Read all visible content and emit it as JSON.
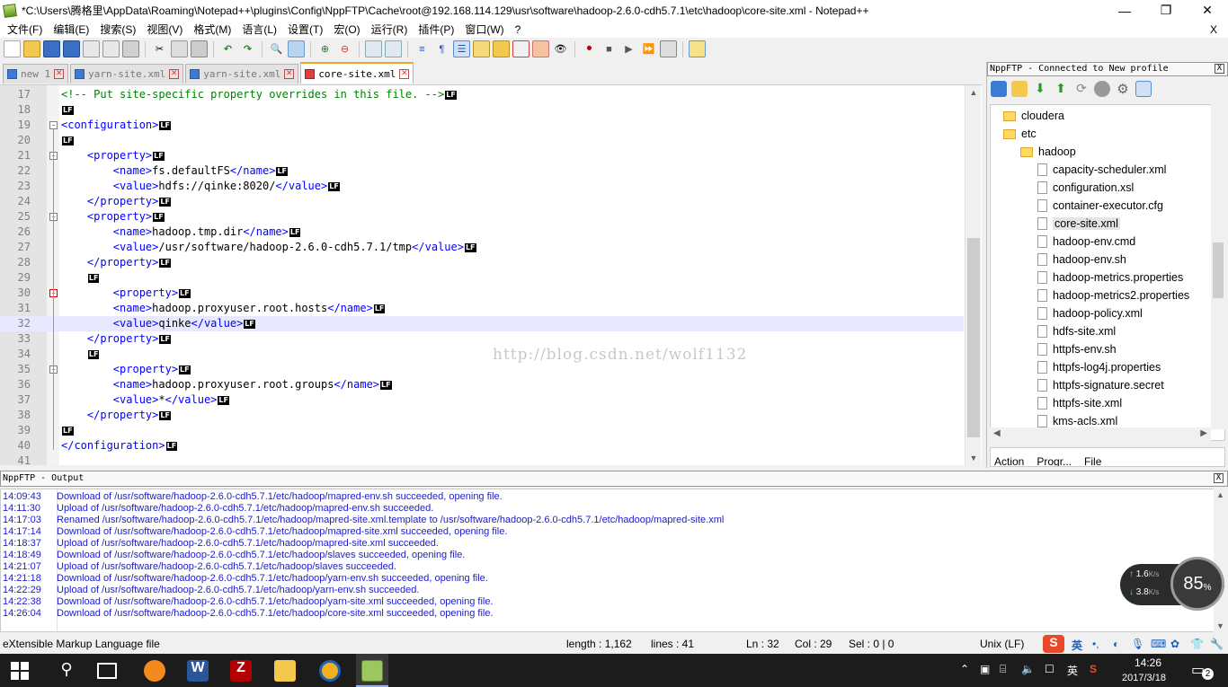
{
  "window": {
    "title": "*C:\\Users\\腾格里\\AppData\\Roaming\\Notepad++\\plugins\\Config\\NppFTP\\Cache\\root@192.168.114.129\\usr\\software\\hadoop-2.6.0-cdh5.7.1\\etc\\hadoop\\core-site.xml - Notepad++",
    "minimize": "—",
    "maximize": "❐",
    "close": "✕"
  },
  "menu": [
    "文件(F)",
    "编辑(E)",
    "搜索(S)",
    "视图(V)",
    "格式(M)",
    "语言(L)",
    "设置(T)",
    "宏(O)",
    "运行(R)",
    "插件(P)",
    "窗口(W)",
    "?"
  ],
  "menu_close": "X",
  "tabs": [
    {
      "label": "new 1",
      "active": false
    },
    {
      "label": "yarn-site.xml",
      "active": false
    },
    {
      "label": "yarn-site.xml",
      "active": false
    },
    {
      "label": "core-site.xml",
      "active": true
    }
  ],
  "tab_close_glyph": "✕",
  "eol_marker": "LF",
  "editor_lines": [
    {
      "n": "17",
      "html": "<span class='cmt'>&lt;!-- Put site-specific property overrides in this file. --&gt;</span>"
    },
    {
      "n": "18",
      "html": ""
    },
    {
      "n": "19",
      "html": "<span class='tag'>&lt;configuration&gt;</span>"
    },
    {
      "n": "20",
      "html": ""
    },
    {
      "n": "21",
      "html": "    <span class='tag'>&lt;property&gt;</span>"
    },
    {
      "n": "22",
      "html": "        <span class='tag'>&lt;name&gt;</span>fs.defaultFS<span class='tag'>&lt;/name&gt;</span>"
    },
    {
      "n": "23",
      "html": "        <span class='tag'>&lt;value&gt;</span>hdfs://qinke:8020/<span class='tag'>&lt;/value&gt;</span>"
    },
    {
      "n": "24",
      "html": "    <span class='tag'>&lt;/property&gt;</span>"
    },
    {
      "n": "25",
      "html": "    <span class='tag'>&lt;property&gt;</span>"
    },
    {
      "n": "26",
      "html": "        <span class='tag'>&lt;name&gt;</span>hadoop.tmp.dir<span class='tag'>&lt;/name&gt;</span>"
    },
    {
      "n": "27",
      "html": "        <span class='tag'>&lt;value&gt;</span>/usr/software/hadoop-2.6.0-cdh5.7.1/tmp<span class='tag'>&lt;/value&gt;</span>"
    },
    {
      "n": "28",
      "html": "    <span class='tag'>&lt;/property&gt;</span>"
    },
    {
      "n": "29",
      "html": "    "
    },
    {
      "n": "30",
      "html": "        <span class='tag'>&lt;property&gt;</span>"
    },
    {
      "n": "31",
      "html": "        <span class='tag'>&lt;name&gt;</span>hadoop.proxyuser.root.hosts<span class='tag'>&lt;/name&gt;</span>"
    },
    {
      "n": "32",
      "html": "        <span class='tag'>&lt;value&gt;</span>qinke<span class='tag'>&lt;/value&gt;</span>"
    },
    {
      "n": "33",
      "html": "    <span class='tag'>&lt;/property&gt;</span>"
    },
    {
      "n": "34",
      "html": "    "
    },
    {
      "n": "35",
      "html": "        <span class='tag'>&lt;property&gt;</span>"
    },
    {
      "n": "36",
      "html": "        <span class='tag'>&lt;name&gt;</span>hadoop.proxyuser.root.groups<span class='tag'>&lt;/name&gt;</span>"
    },
    {
      "n": "37",
      "html": "        <span class='tag'>&lt;value&gt;</span>*<span class='tag'>&lt;/value&gt;</span>"
    },
    {
      "n": "38",
      "html": "    <span class='tag'>&lt;/property&gt;</span>"
    },
    {
      "n": "39",
      "html": ""
    },
    {
      "n": "40",
      "html": "<span class='tag'>&lt;/configuration&gt;</span>"
    },
    {
      "n": "41",
      "html": null
    }
  ],
  "current_line": "32",
  "watermark": "http://blog.csdn.net/wolf1132",
  "ftp": {
    "title": "NppFTP - Connected to New profile",
    "close": "X",
    "tree": [
      {
        "label": "cloudera",
        "type": "folder",
        "depth": 0
      },
      {
        "label": "etc",
        "type": "folder",
        "depth": 0
      },
      {
        "label": "hadoop",
        "type": "folder",
        "depth": 1
      },
      {
        "label": "capacity-scheduler.xml",
        "type": "file",
        "depth": 2
      },
      {
        "label": "configuration.xsl",
        "type": "file",
        "depth": 2
      },
      {
        "label": "container-executor.cfg",
        "type": "file",
        "depth": 2
      },
      {
        "label": "core-site.xml",
        "type": "file",
        "depth": 2,
        "selected": true
      },
      {
        "label": "hadoop-env.cmd",
        "type": "file",
        "depth": 2
      },
      {
        "label": "hadoop-env.sh",
        "type": "file",
        "depth": 2
      },
      {
        "label": "hadoop-metrics.properties",
        "type": "file",
        "depth": 2
      },
      {
        "label": "hadoop-metrics2.properties",
        "type": "file",
        "depth": 2
      },
      {
        "label": "hadoop-policy.xml",
        "type": "file",
        "depth": 2
      },
      {
        "label": "hdfs-site.xml",
        "type": "file",
        "depth": 2
      },
      {
        "label": "httpfs-env.sh",
        "type": "file",
        "depth": 2
      },
      {
        "label": "httpfs-log4j.properties",
        "type": "file",
        "depth": 2
      },
      {
        "label": "httpfs-signature.secret",
        "type": "file",
        "depth": 2
      },
      {
        "label": "httpfs-site.xml",
        "type": "file",
        "depth": 2
      },
      {
        "label": "kms-acls.xml",
        "type": "file",
        "depth": 2
      }
    ],
    "queue_columns": [
      "Action",
      "Progr...",
      "File"
    ]
  },
  "output": {
    "title": "NppFTP - Output",
    "close": "X",
    "lines": [
      {
        "t": "14:09:43",
        "msg": "Download of /usr/software/hadoop-2.6.0-cdh5.7.1/etc/hadoop/mapred-env.sh succeeded, opening file."
      },
      {
        "t": "14:11:30",
        "msg": "Upload of /usr/software/hadoop-2.6.0-cdh5.7.1/etc/hadoop/mapred-env.sh succeeded."
      },
      {
        "t": "14:17:03",
        "msg": "Renamed /usr/software/hadoop-2.6.0-cdh5.7.1/etc/hadoop/mapred-site.xml.template to /usr/software/hadoop-2.6.0-cdh5.7.1/etc/hadoop/mapred-site.xml"
      },
      {
        "t": "14:17:14",
        "msg": "Download of /usr/software/hadoop-2.6.0-cdh5.7.1/etc/hadoop/mapred-site.xml succeeded, opening file."
      },
      {
        "t": "14:18:37",
        "msg": "Upload of /usr/software/hadoop-2.6.0-cdh5.7.1/etc/hadoop/mapred-site.xml succeeded."
      },
      {
        "t": "14:18:49",
        "msg": "Download of /usr/software/hadoop-2.6.0-cdh5.7.1/etc/hadoop/slaves succeeded, opening file."
      },
      {
        "t": "14:21:07",
        "msg": "Upload of /usr/software/hadoop-2.6.0-cdh5.7.1/etc/hadoop/slaves succeeded."
      },
      {
        "t": "14:21:18",
        "msg": "Download of /usr/software/hadoop-2.6.0-cdh5.7.1/etc/hadoop/yarn-env.sh succeeded, opening file."
      },
      {
        "t": "14:22:29",
        "msg": "Upload of /usr/software/hadoop-2.6.0-cdh5.7.1/etc/hadoop/yarn-env.sh succeeded."
      },
      {
        "t": "14:22:38",
        "msg": "Download of /usr/software/hadoop-2.6.0-cdh5.7.1/etc/hadoop/yarn-site.xml succeeded, opening file."
      },
      {
        "t": "14:26:04",
        "msg": "Download of /usr/software/hadoop-2.6.0-cdh5.7.1/etc/hadoop/core-site.xml succeeded, opening file."
      }
    ]
  },
  "status": {
    "filetype": "eXtensible Markup Language file",
    "length": "length : 1,162",
    "lines": "lines : 41",
    "ln": "Ln : 32",
    "col": "Col : 29",
    "sel": "Sel : 0 | 0",
    "eol": "Unix (LF)",
    "ime": "英"
  },
  "speed": {
    "up": "1.6",
    "down": "3.8",
    "unit": "K/s",
    "cpu": "85",
    "cpu_unit": "%"
  },
  "taskbar": {
    "time": "14:26",
    "date": "2017/3/18",
    "ime": "英",
    "notifications": "2"
  },
  "colors": {
    "tag": "#0000ff",
    "comment": "#008000",
    "output_text": "#1c1ccc",
    "active_tab_accent": "#f5a623",
    "current_line": "#e8e8ff"
  }
}
